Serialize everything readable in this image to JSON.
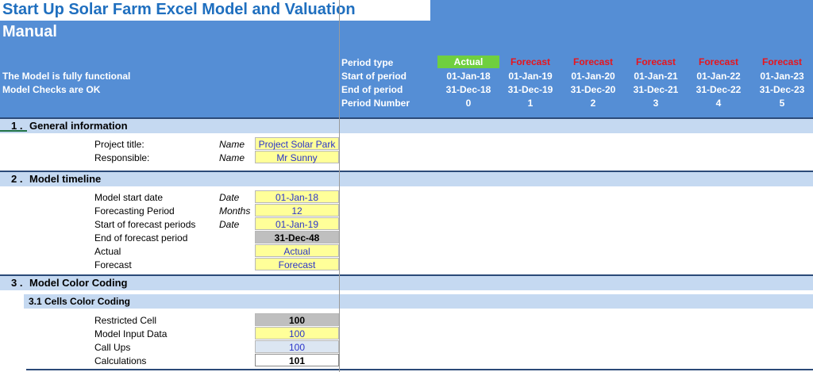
{
  "header": {
    "title": "Start Up Solar Farm Excel Model and Valuation",
    "subtitle": "Manual",
    "status_functional": "The Model is fully functional",
    "status_checks": "Model Checks are OK",
    "row_labels": {
      "period_type": "Period type",
      "start_of_period": "Start of period",
      "end_of_period": "End of period",
      "period_number": "Period Number"
    },
    "periods": [
      {
        "type": "Actual",
        "start": "01-Jan-18",
        "end": "31-Dec-18",
        "number": "0"
      },
      {
        "type": "Forecast",
        "start": "01-Jan-19",
        "end": "31-Dec-19",
        "number": "1"
      },
      {
        "type": "Forecast",
        "start": "01-Jan-20",
        "end": "31-Dec-20",
        "number": "2"
      },
      {
        "type": "Forecast",
        "start": "01-Jan-21",
        "end": "31-Dec-21",
        "number": "3"
      },
      {
        "type": "Forecast",
        "start": "01-Jan-22",
        "end": "31-Dec-22",
        "number": "4"
      },
      {
        "type": "Forecast",
        "start": "01-Jan-23",
        "end": "31-Dec-23",
        "number": "5"
      }
    ],
    "colors": {
      "actual": "#6fcf3f",
      "forecast_text": "#e8141c",
      "header_bg": "#558ed5"
    }
  },
  "sections": {
    "general": {
      "num": "1 .",
      "title": "General information",
      "rows": [
        {
          "label": "Project title:",
          "unit": "Name",
          "value": "Project Solar Park"
        },
        {
          "label": "Responsible:",
          "unit": "Name",
          "value": "Mr Sunny"
        }
      ]
    },
    "timeline": {
      "num": "2 .",
      "title": "Model timeline",
      "rows": [
        {
          "label": "Model start date",
          "unit": "Date",
          "value": "01-Jan-18"
        },
        {
          "label": "Forecasting Period",
          "unit": "Months",
          "value": "12"
        },
        {
          "label": "Start of forecast periods",
          "unit": "Date",
          "value": "01-Jan-19"
        },
        {
          "label": "End of forecast period",
          "unit": "",
          "value": "31-Dec-48"
        },
        {
          "label": "Actual",
          "unit": "",
          "value": "Actual"
        },
        {
          "label": "Forecast",
          "unit": "",
          "value": "Forecast"
        }
      ]
    },
    "colorcoding": {
      "num": "3 .",
      "title": "Model Color Coding",
      "sub_title": "3.1 Cells Color Coding",
      "rows": [
        {
          "label": "Restricted Cell",
          "value": "100"
        },
        {
          "label": "Model Input Data",
          "value": "100"
        },
        {
          "label": "Call Ups",
          "value": "100"
        },
        {
          "label": "Calculations",
          "value": "101"
        }
      ]
    }
  }
}
